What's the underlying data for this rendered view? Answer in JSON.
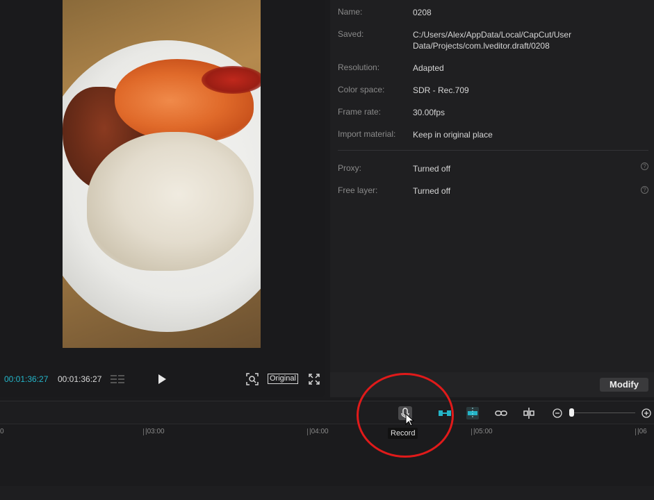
{
  "player": {
    "current_time": "00:01:36:27",
    "total_time": "00:01:36:27",
    "original_label": "Original"
  },
  "details": {
    "rows": [
      {
        "key": "Name:",
        "value": "0208"
      },
      {
        "key": "Saved:",
        "value": "C:/Users/Alex/AppData/Local/CapCut/User Data/Projects/com.lveditor.draft/0208"
      },
      {
        "key": "Resolution:",
        "value": "Adapted"
      },
      {
        "key": "Color space:",
        "value": "SDR - Rec.709"
      },
      {
        "key": "Frame rate:",
        "value": "30.00fps"
      },
      {
        "key": "Import material:",
        "value": "Keep in original place"
      }
    ],
    "extra_rows": [
      {
        "key": "Proxy:",
        "value": "Turned off"
      },
      {
        "key": "Free layer:",
        "value": "Turned off"
      }
    ],
    "modify_label": "Modify"
  },
  "timeline": {
    "tooltip": "Record",
    "ticks": [
      "0",
      "|03:00",
      "|04:00",
      "|05:00",
      "|06"
    ]
  },
  "colors": {
    "accent_timecode": "#24b5c8",
    "annotation": "#e01a1a",
    "split_icons": "#24b5c8"
  }
}
